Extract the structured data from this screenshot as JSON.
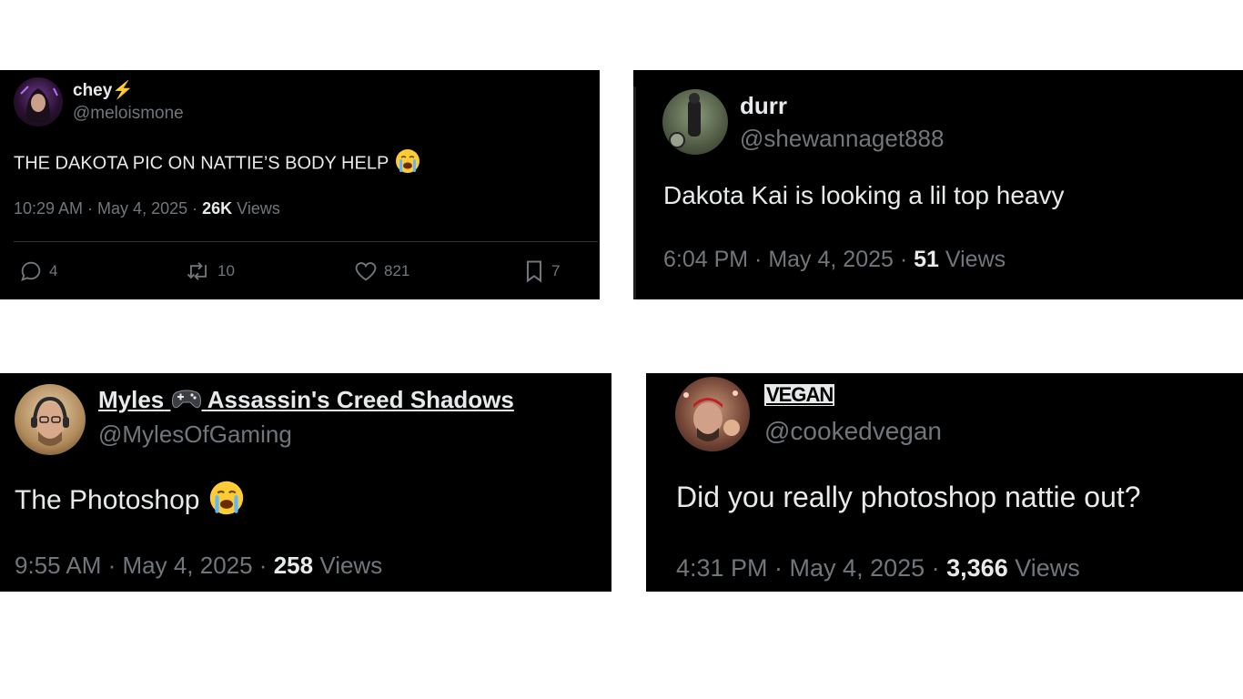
{
  "tweets": [
    {
      "name": "chey",
      "name_suffix": "⚡",
      "handle": "@meloismone",
      "text": "THE DAKOTA PIC ON NATTIE’S BODY HELP",
      "time": "10:29 AM · May 4, 2025 · ",
      "views_count": "26K",
      "views_label": " Views",
      "actions": {
        "replies": "4",
        "reposts": "10",
        "likes": "821",
        "bookmarks": "7"
      }
    },
    {
      "name": "durr",
      "handle": "@shewannaget888",
      "text": "Dakota Kai is looking a lil top heavy",
      "time": "6:04 PM · May 4, 2025 · ",
      "views_count": "51",
      "views_label": " Views"
    },
    {
      "name_part1": "Myles",
      "name_part2": "Assassin's Creed Shadows",
      "handle": "@MylesOfGaming",
      "text": "The Photoshop",
      "time": "9:55 AM · May 4, 2025 · ",
      "views_count": "258",
      "views_label": " Views"
    },
    {
      "name": "VEGAN",
      "handle": "@cookedvegan",
      "text": "Did you really photoshop nattie out?",
      "time": "4:31 PM · May 4, 2025 · ",
      "views_count": "3,366",
      "views_label": " Views"
    }
  ],
  "icons": [
    "reply-icon",
    "repost-icon",
    "like-icon",
    "bookmark-icon",
    "crying-emoji",
    "gamepad-emoji",
    "lightning-emoji"
  ],
  "colors": {
    "background": "#000000",
    "text": "#e7e9ea",
    "muted": "#71767b"
  }
}
